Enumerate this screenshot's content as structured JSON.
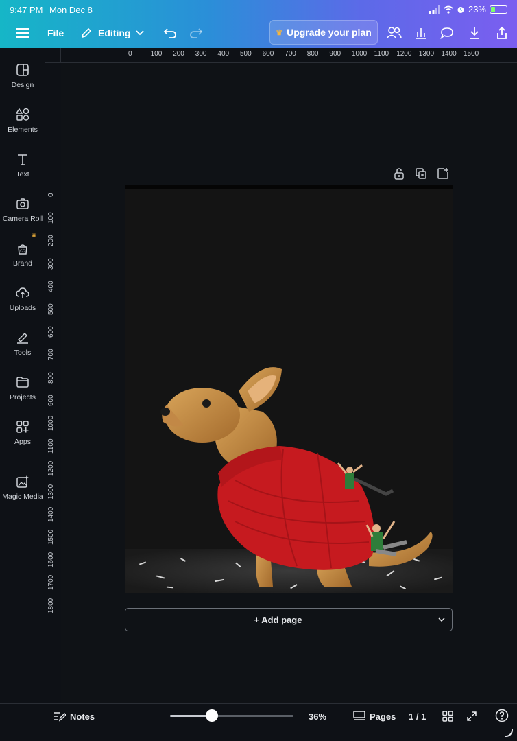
{
  "status": {
    "time": "9:47 PM",
    "date": "Mon Dec 8",
    "battery": "23%"
  },
  "toolbar": {
    "file_label": "File",
    "editing_label": "Editing",
    "upgrade_label": "Upgrade your plan"
  },
  "sidebar": {
    "items": [
      {
        "label": "Design",
        "icon": "design-icon"
      },
      {
        "label": "Elements",
        "icon": "elements-icon"
      },
      {
        "label": "Text",
        "icon": "text-icon"
      },
      {
        "label": "Camera Roll",
        "icon": "camera-icon"
      },
      {
        "label": "Brand",
        "icon": "brand-icon"
      },
      {
        "label": "Uploads",
        "icon": "uploads-icon"
      },
      {
        "label": "Tools",
        "icon": "tools-icon"
      },
      {
        "label": "Projects",
        "icon": "projects-icon"
      },
      {
        "label": "Apps",
        "icon": "apps-icon"
      },
      {
        "label": "Magic Media",
        "icon": "magic-media-icon"
      }
    ]
  },
  "ruler": {
    "top": [
      "0",
      "100",
      "200",
      "300",
      "400",
      "500",
      "600",
      "700",
      "800",
      "900",
      "1000",
      "1100",
      "1200",
      "1300",
      "1400",
      "1500"
    ],
    "left": [
      "0",
      "100",
      "200",
      "300",
      "400",
      "500",
      "600",
      "700",
      "800",
      "900",
      "1000",
      "1100",
      "1200",
      "1300",
      "1400",
      "1500",
      "1600",
      "1700",
      "1800"
    ]
  },
  "canvas": {
    "add_page_label": "+ Add page"
  },
  "bottom": {
    "notes_label": "Notes",
    "zoom": "36%",
    "zoom_fraction": 0.34,
    "pages_label": "Pages",
    "page_count": "1 / 1"
  },
  "colors": {
    "accent_gradient_start": "#16b6c7",
    "accent_gradient_end": "#7b5ef0",
    "crown": "#f5b63c"
  }
}
